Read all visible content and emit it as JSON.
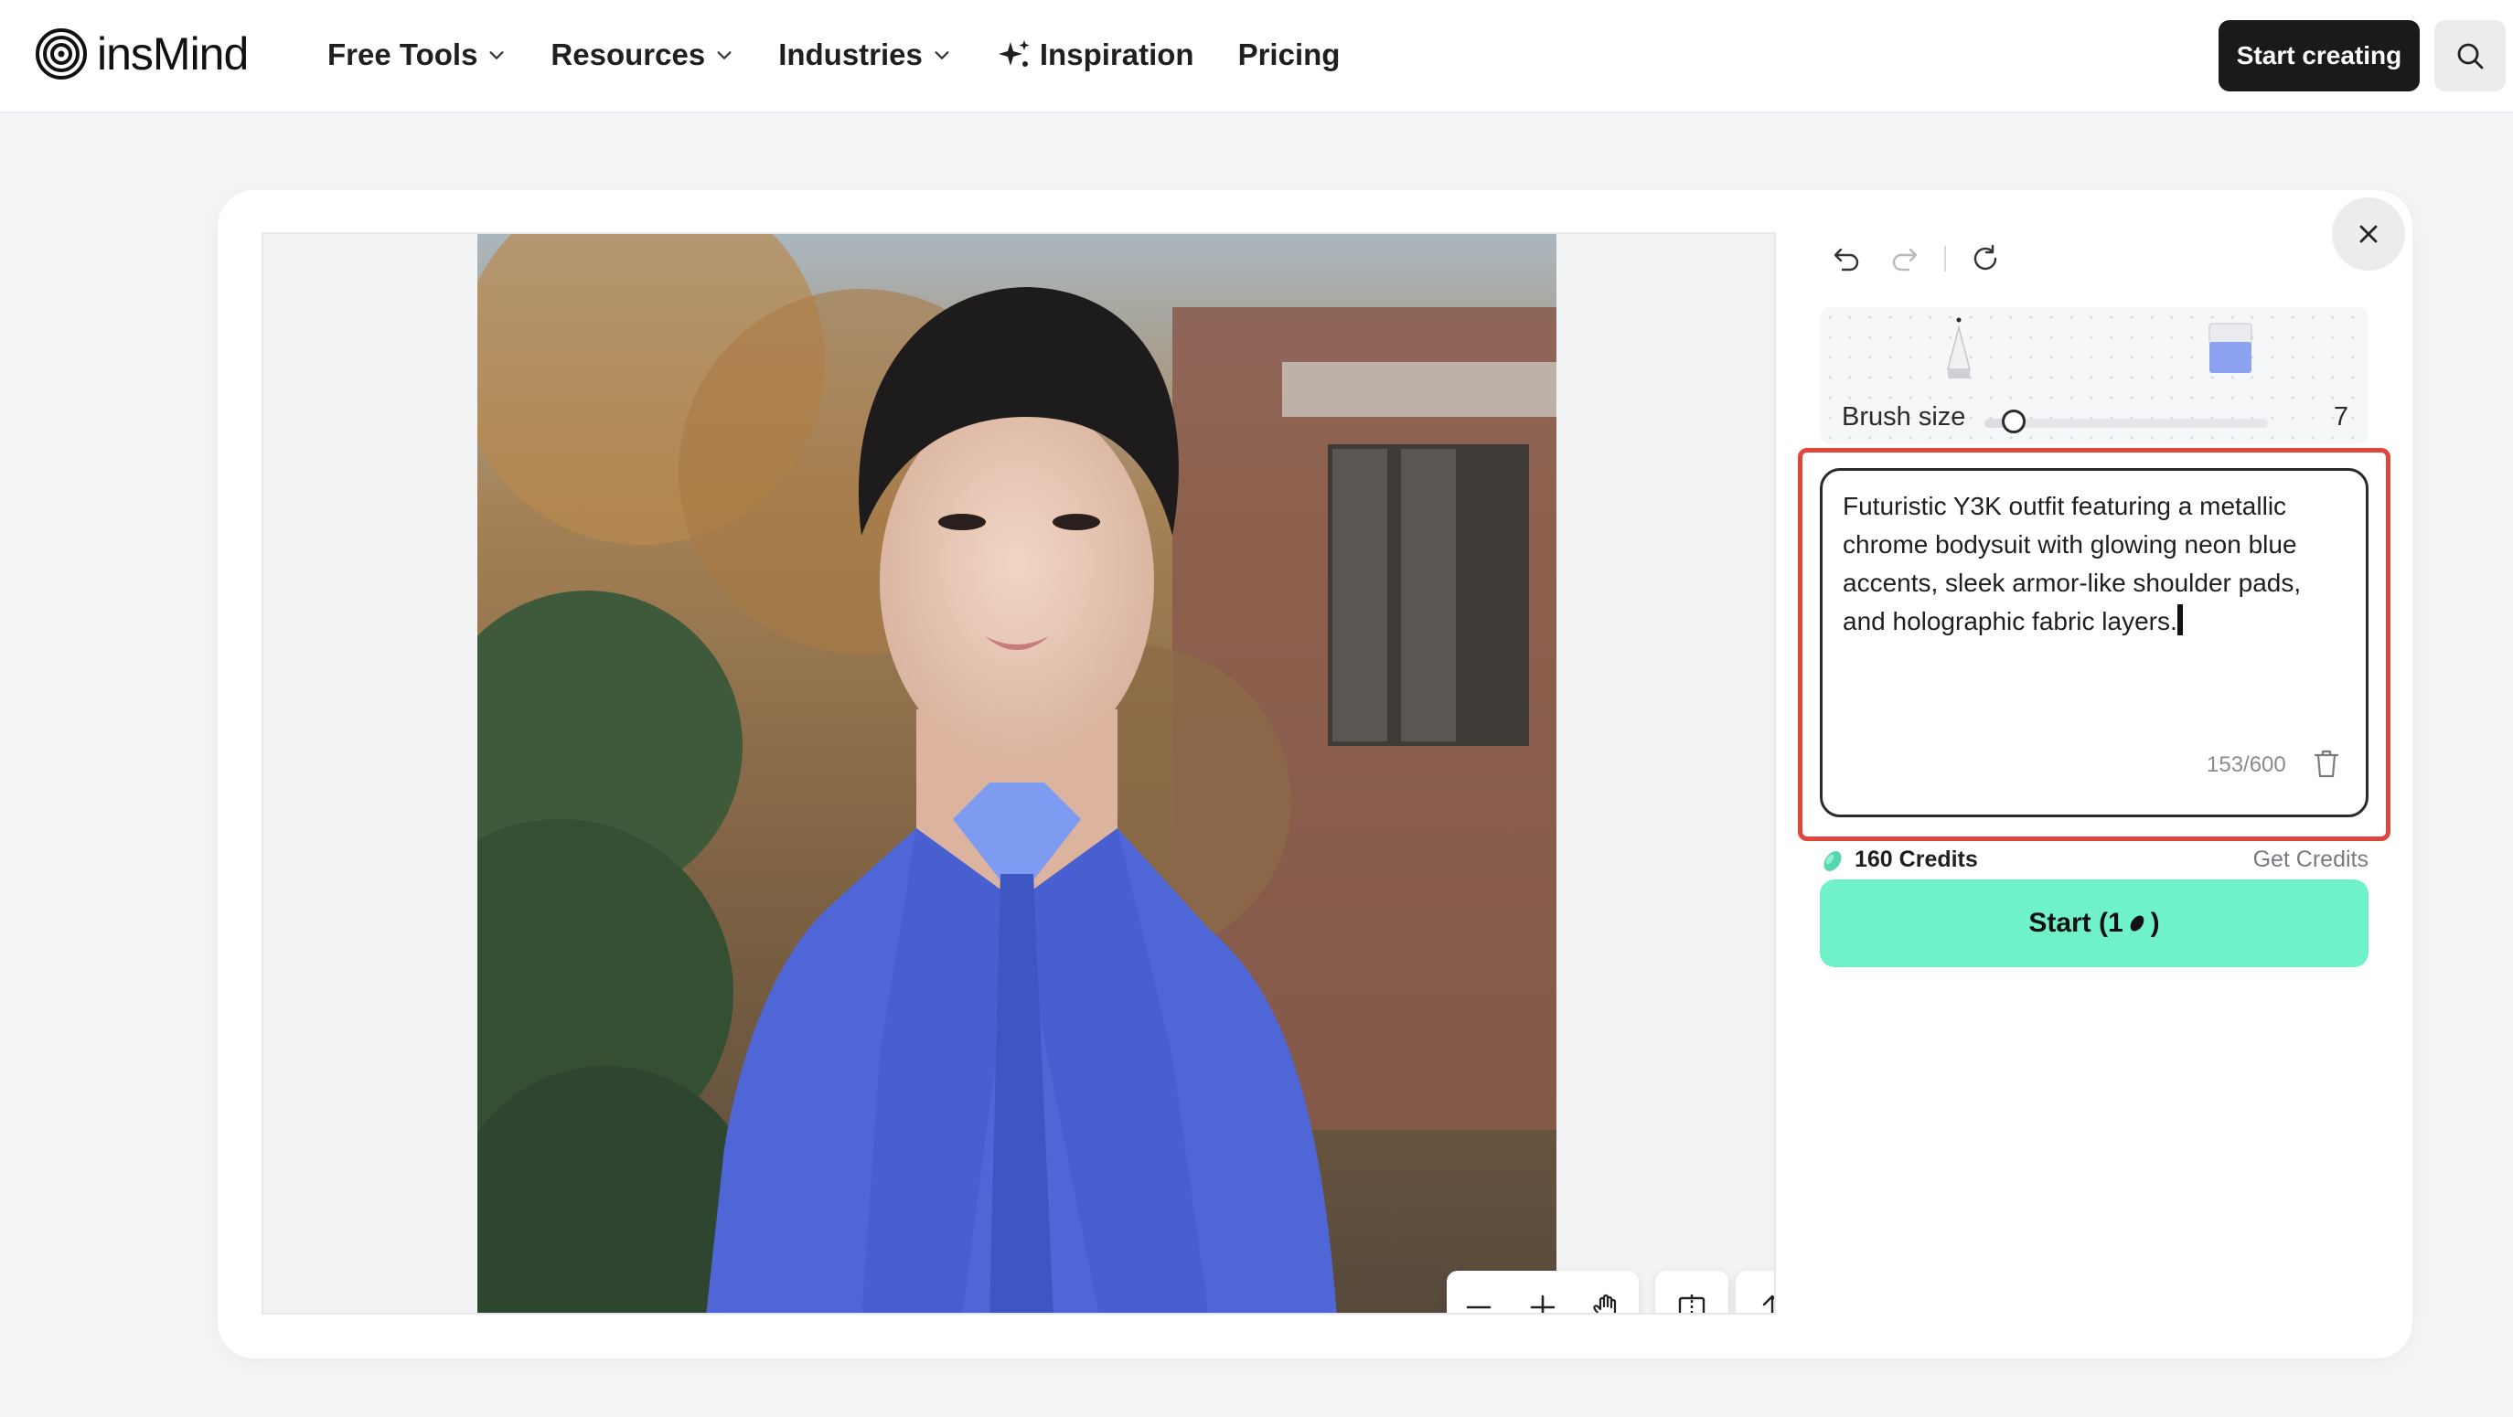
{
  "header": {
    "logo_text": "insMind",
    "nav": [
      {
        "label": "Free Tools",
        "has_dropdown": true
      },
      {
        "label": "Resources",
        "has_dropdown": true
      },
      {
        "label": "Industries",
        "has_dropdown": true
      },
      {
        "label": "Inspiration",
        "icon": "sparkle-icon"
      },
      {
        "label": "Pricing"
      }
    ],
    "cta_label": "Start creating"
  },
  "editor": {
    "brush": {
      "label": "Brush size",
      "value": "7",
      "level_fraction": 0.07
    },
    "prompt": {
      "text": "Futuristic Y3K outfit featuring a metallic chrome bodysuit with glowing neon blue accents, sleek armor-like shoulder pads, and holographic fabric layers.",
      "char_count": "153/600"
    },
    "credits": {
      "text": "160 Credits",
      "get_label": "Get Credits"
    },
    "start": {
      "label_prefix": "Start (1",
      "label_suffix": ")"
    }
  },
  "colors": {
    "accent": "#6ff2c9",
    "highlight": "#e0463b",
    "mask": "#4f67d6"
  }
}
